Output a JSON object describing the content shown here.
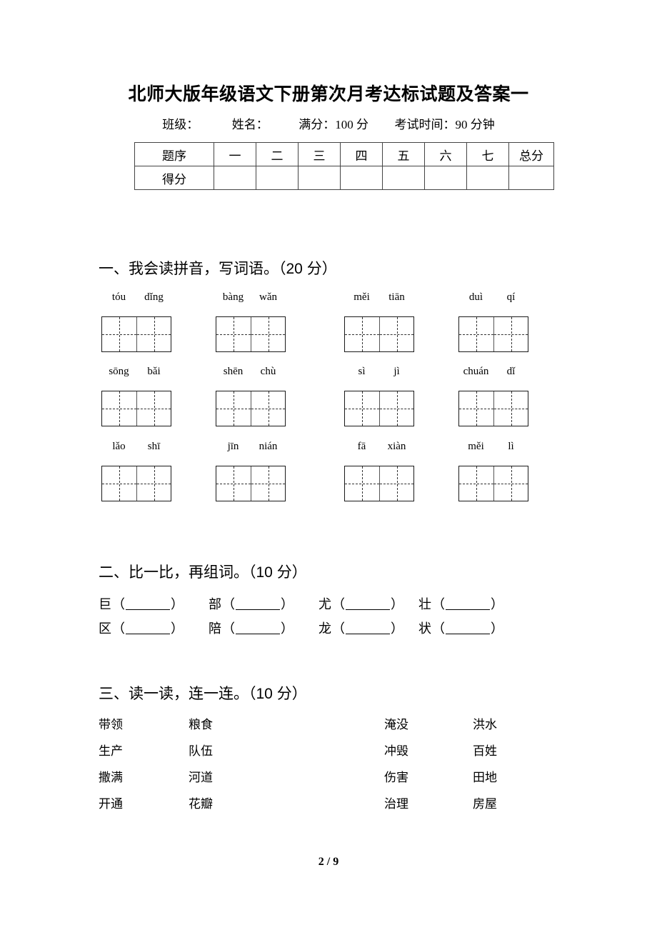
{
  "document": {
    "title": "北师大版年级语文下册第次月考达标试题及答案一",
    "subtitle": {
      "class_label": "班级：",
      "name_label": "姓名：",
      "full_marks": "满分：100 分",
      "exam_time": "考试时间：90 分钟"
    },
    "footer": "2 / 9"
  },
  "score_table": {
    "row_labels": [
      "题序",
      "得分"
    ],
    "columns": [
      "一",
      "二",
      "三",
      "四",
      "五",
      "六",
      "七",
      "总分"
    ],
    "scores": [
      "",
      "",
      "",
      "",
      "",
      "",
      "",
      ""
    ]
  },
  "sections": [
    {
      "heading": "一、我会读拼音，写词语。（20 分）",
      "rows": [
        {
          "groups": [
            {
              "syllables": [
                "tóu",
                "dǐng"
              ]
            },
            {
              "syllables": [
                "bàng",
                "wǎn"
              ]
            },
            {
              "syllables": [
                "měi",
                "tiān"
              ]
            },
            {
              "syllables": [
                "duì",
                "qí"
              ]
            }
          ]
        },
        {
          "groups": [
            {
              "syllables": [
                "sōng",
                "bǎi"
              ]
            },
            {
              "syllables": [
                "shēn",
                "chù"
              ]
            },
            {
              "syllables": [
                "sì",
                "jì"
              ]
            },
            {
              "syllables": [
                "chuán",
                "dǐ"
              ]
            }
          ]
        },
        {
          "groups": [
            {
              "syllables": [
                "lǎo",
                "shī"
              ]
            },
            {
              "syllables": [
                "jīn",
                "nián"
              ]
            },
            {
              "syllables": [
                "fā",
                "xiàn"
              ]
            },
            {
              "syllables": [
                "měi",
                "lì"
              ]
            }
          ]
        }
      ]
    },
    {
      "heading": "二、比一比，再组词。（10 分）",
      "rows": [
        {
          "items": [
            "巨",
            "部",
            "尤",
            "壮"
          ]
        },
        {
          "items": [
            "区",
            "陪",
            "龙",
            "状"
          ]
        }
      ],
      "paren_open": "（",
      "paren_close": "）"
    },
    {
      "heading": "三、读一读，连一连。（10 分）",
      "rows": [
        {
          "words": [
            "带领",
            "粮食",
            "淹没",
            "洪水"
          ]
        },
        {
          "words": [
            "生产",
            "队伍",
            "冲毁",
            "百姓"
          ]
        },
        {
          "words": [
            "撒满",
            "河道",
            "伤害",
            "田地"
          ]
        },
        {
          "words": [
            "开通",
            "花瓣",
            "治理",
            "房屋"
          ]
        }
      ]
    }
  ]
}
